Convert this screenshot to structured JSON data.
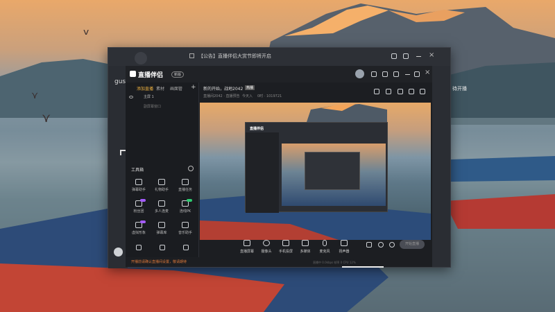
{
  "outer_window": {
    "notice_text": "【公告】直播伴侣大赏节即将开启",
    "side_label": "gusc",
    "right_label": "待开播"
  },
  "app": {
    "title": "直播伴侣",
    "version_badge": "新版",
    "sidebar_tabs": [
      {
        "label": "添加直播",
        "active": true
      },
      {
        "label": "素材",
        "active": false
      },
      {
        "label": "画面管",
        "active": false
      }
    ],
    "scenes": [
      {
        "label": "主屏 1"
      },
      {
        "label": "副屏幕窗口"
      }
    ],
    "toolbox_title": "工具箱",
    "tools": [
      {
        "label": "弹幕助手"
      },
      {
        "label": "礼物助手"
      },
      {
        "label": "直播任务"
      },
      {
        "label": "粉丝团",
        "badge_color": "#a55cff"
      },
      {
        "label": "多人连麦"
      },
      {
        "label": "连线PK",
        "badge_color": "#2ecc71"
      },
      {
        "label": "虚拟形象",
        "badge_color": "#a55cff"
      },
      {
        "label": "弹幕库"
      },
      {
        "label": "音乐助手"
      },
      {
        "label": ""
      },
      {
        "label": ""
      },
      {
        "label": ""
      }
    ],
    "warning_text": "开播前请确认直播间设置，敬请期待",
    "stream_title": "新的开始，战地2042",
    "stream_tag": "热播",
    "stream_meta_1": "直播间2042 · 直播预告",
    "stream_meta_2": "今天入",
    "stream_meta_3": "0时 · 1019721",
    "bottom_buttons": [
      {
        "label": "直播屏幕"
      },
      {
        "label": "摄像头"
      },
      {
        "label": "手机投屏"
      },
      {
        "label": "多媒体"
      },
      {
        "label": "麦克风"
      },
      {
        "label": "扬声器"
      }
    ],
    "start_button": "开始直播",
    "status_bar": "直播中 0.0kbps  帧率 0  CPU 12%"
  },
  "colors": {
    "accent": "#f0b340",
    "start_button": "#4a4d55"
  }
}
